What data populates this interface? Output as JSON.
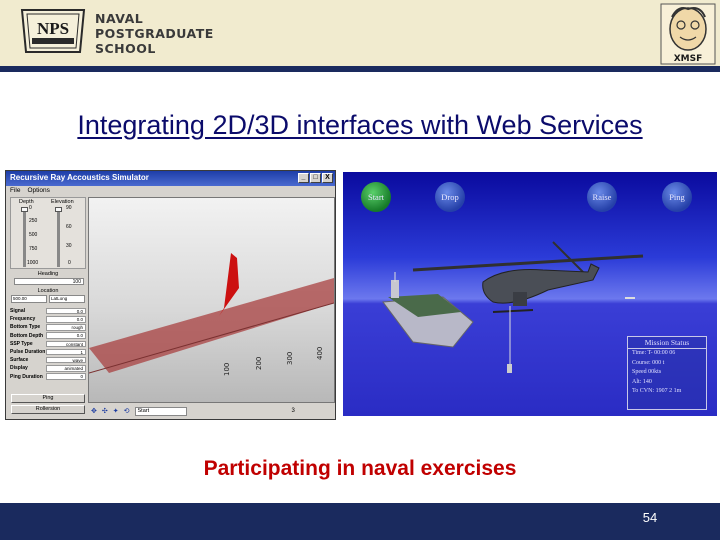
{
  "header": {
    "school_lines": [
      "NAVAL",
      "POSTGRADUATE",
      "SCHOOL"
    ],
    "seal_text": "NPS",
    "xmsf_text": "XMSF",
    "colors": {
      "header_bg": "#f1ebcf",
      "navy": "#1a2a5e"
    }
  },
  "slide": {
    "title": "Integrating 2D/3D interfaces with Web Services",
    "caption": "Participating in naval exercises",
    "page_number": "54",
    "colors": {
      "title": "#0b0b6b",
      "caption": "#c00000"
    }
  },
  "simulator": {
    "window_title": "Recursive Ray Accoustics Simulator",
    "window_buttons": [
      "_",
      "□",
      "X"
    ],
    "menu": [
      "File",
      "Options"
    ],
    "depth_label": "Depth",
    "elevation_label": "Elevation",
    "depth_ticks": [
      "0",
      "250",
      "500",
      "750",
      "1000"
    ],
    "elevation_ticks": [
      "90",
      "60",
      "30",
      "0"
    ],
    "heading_label": "Heading",
    "heading_value": "100",
    "location_label": "Location",
    "location_values": [
      "500.00",
      "LatLong"
    ],
    "parameters": [
      {
        "name": "Signal",
        "value": "0.0"
      },
      {
        "name": "Frequency",
        "value": "0.0"
      },
      {
        "name": "Bottom Type",
        "value": "rough"
      },
      {
        "name": "Bottom Depth",
        "value": "0.0"
      },
      {
        "name": "SSP Type",
        "value": "constant"
      },
      {
        "name": "Pulse Duration",
        "value": "1"
      },
      {
        "name": "Surface",
        "value": "wave"
      },
      {
        "name": "Display",
        "value": "animated"
      },
      {
        "name": "Ping Duration",
        "value": "0"
      }
    ],
    "buttons": [
      "Ping",
      "Rollersion"
    ],
    "viewport_labels": [
      "100",
      "200",
      "300",
      "400"
    ],
    "toolbar_select": "Start",
    "toolbar_number": "3"
  },
  "scene": {
    "buttons": [
      {
        "label": "Start",
        "color": "green"
      },
      {
        "label": "Drop",
        "color": "blue"
      },
      {
        "label": "Raise",
        "color": "blue"
      },
      {
        "label": "Ping",
        "color": "blue"
      }
    ],
    "mission_status": {
      "title": "Mission Status",
      "lines": [
        "Time: T- 00:00 06",
        "Course: 000 t",
        "Speed 00kts",
        "Alt: 140",
        "To CVN: 1907  2 1m"
      ]
    }
  }
}
